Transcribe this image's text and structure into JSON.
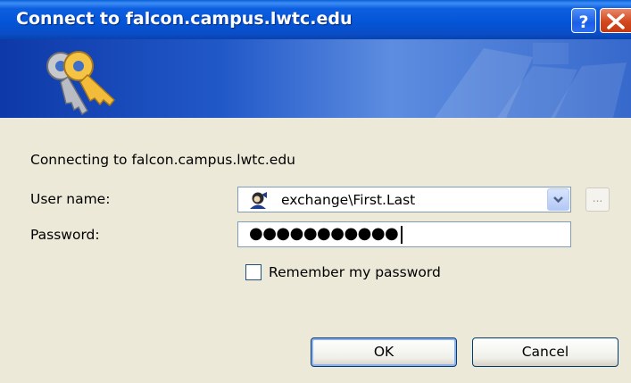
{
  "window": {
    "title": "Connect to falcon.campus.lwtc.edu"
  },
  "titlebar": {
    "help_icon": "question-mark",
    "close_icon": "x"
  },
  "banner": {
    "icon": "keys-icon"
  },
  "body": {
    "connecting_text": "Connecting to falcon.campus.lwtc.edu",
    "username_label": "User name:",
    "username_value": "exchange\\First.Last",
    "browse_label": "...",
    "password_label": "Password:",
    "password_mask": "●●●●●●●●●●●",
    "remember_label": "Remember my password",
    "remember_checked": false
  },
  "buttons": {
    "ok": "OK",
    "cancel": "Cancel"
  },
  "colors": {
    "title_blue": "#0454d6",
    "close_red": "#d3471d",
    "dialog_bg": "#ece9d8"
  }
}
